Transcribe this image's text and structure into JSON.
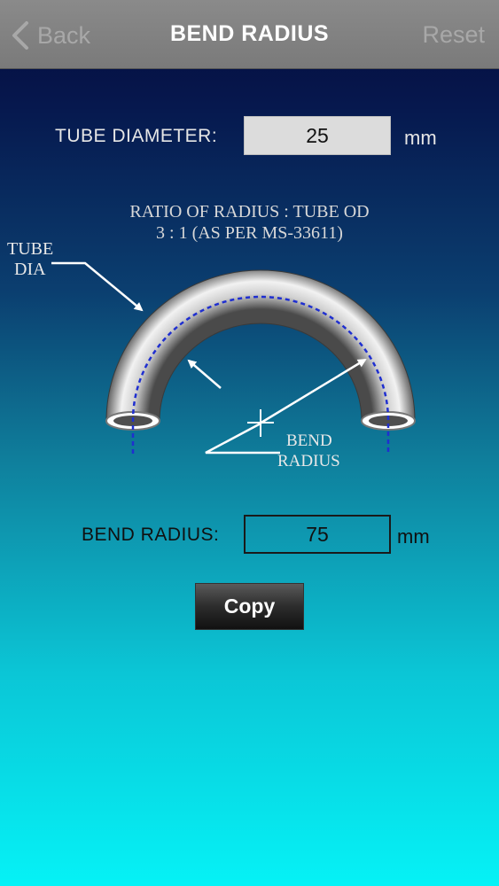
{
  "nav": {
    "back_label": "Back",
    "title": "BEND RADIUS",
    "reset_label": "Reset"
  },
  "tube_diameter": {
    "label": "TUBE DIAMETER:",
    "value": "25",
    "unit": "mm"
  },
  "diagram": {
    "ratio_line1": "RATIO OF RADIUS : TUBE OD",
    "ratio_line2": "3 : 1  (AS PER MS-33611)",
    "tube_dia_line1": "TUBE",
    "tube_dia_line2": "DIA",
    "bend_radius_line1": "BEND",
    "bend_radius_line2": "RADIUS"
  },
  "bend_radius": {
    "label": "BEND RADIUS:",
    "value": "75",
    "unit": "mm"
  },
  "copy_label": "Copy",
  "colors": {
    "navbar": "#7f7f7f",
    "centerline": "#1f2fd0",
    "bg_top": "#040a3a",
    "bg_bottom": "#05f2f6"
  }
}
